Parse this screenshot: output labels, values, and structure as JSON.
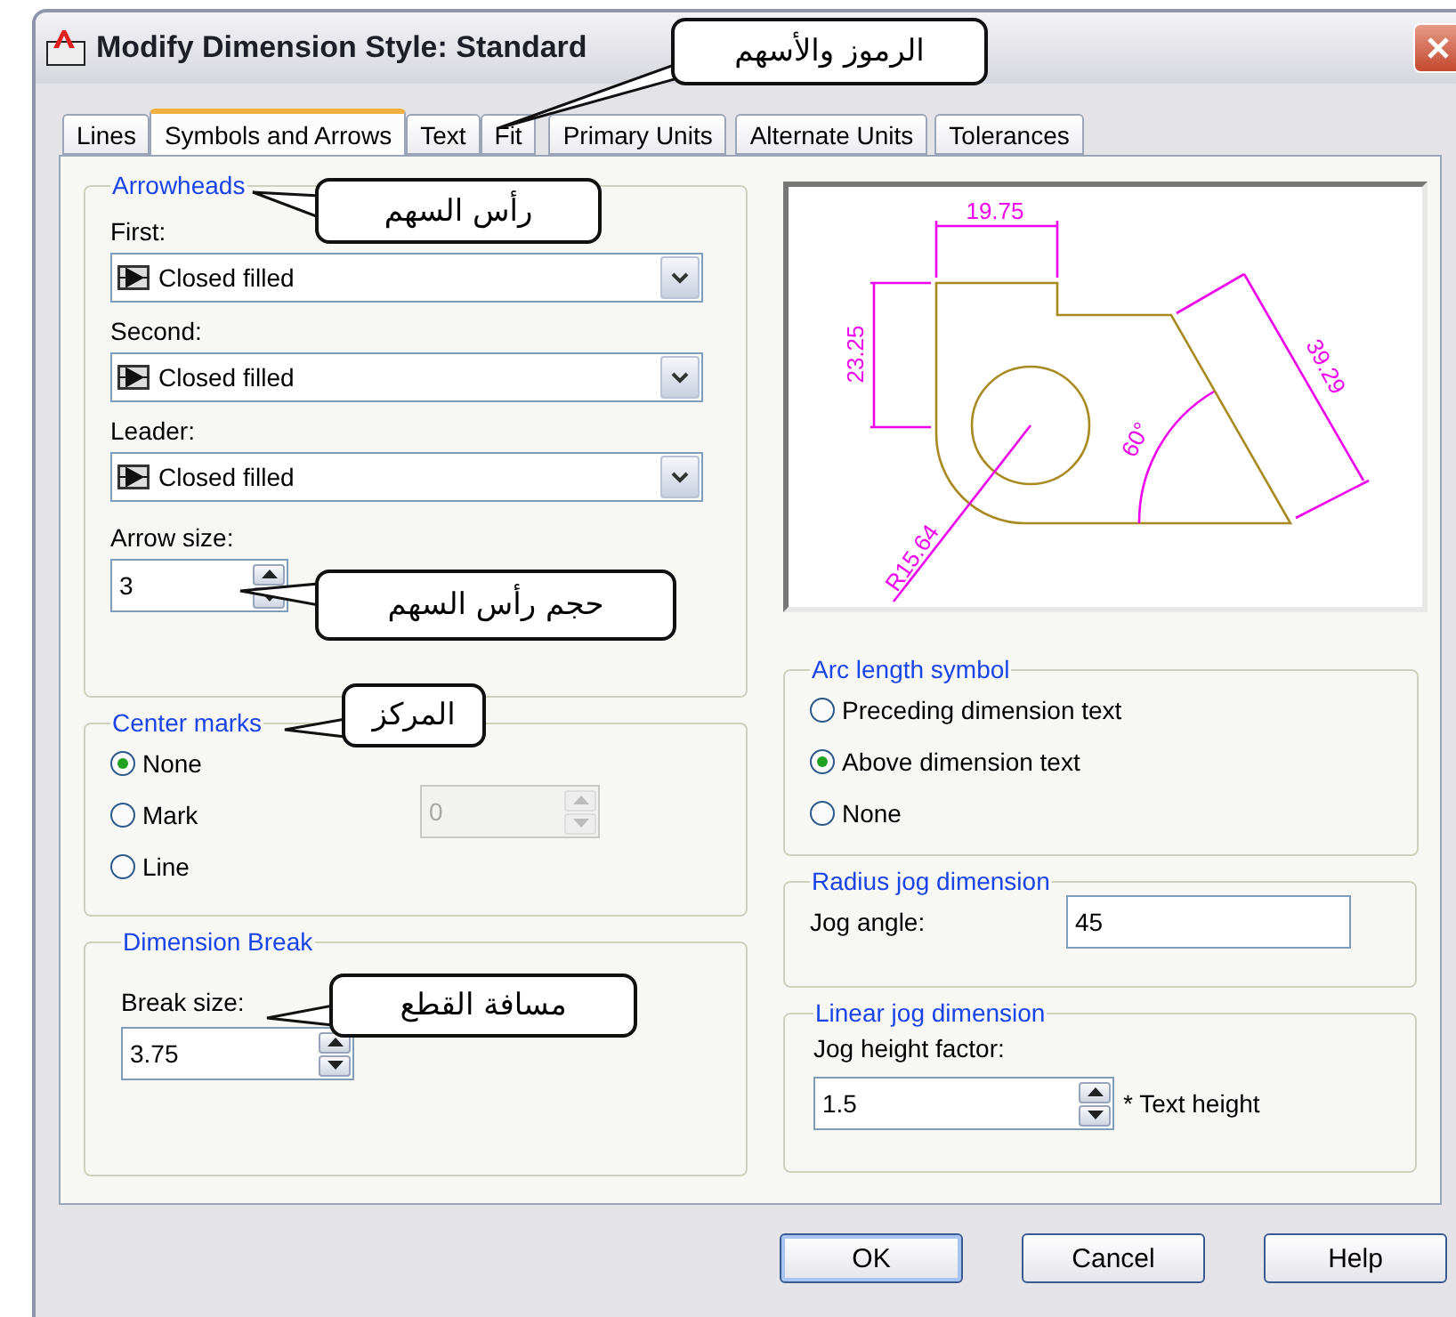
{
  "window": {
    "title": "Modify Dimension Style: Standard"
  },
  "tabs": [
    {
      "label": "Lines",
      "selected": false
    },
    {
      "label": "Symbols and Arrows",
      "selected": true
    },
    {
      "label": "Text",
      "selected": false
    },
    {
      "label": "Fit",
      "selected": false
    },
    {
      "label": "Primary Units",
      "selected": false
    },
    {
      "label": "Alternate Units",
      "selected": false
    },
    {
      "label": "Tolerances",
      "selected": false
    }
  ],
  "arrowheads": {
    "title": "Arrowheads",
    "fields": [
      {
        "label": "First:",
        "value": "Closed filled"
      },
      {
        "label": "Second:",
        "value": "Closed filled"
      },
      {
        "label": "Leader:",
        "value": "Closed filled"
      }
    ],
    "arrow_size": {
      "label": "Arrow size:",
      "value": "3"
    }
  },
  "center_marks": {
    "title": "Center marks",
    "options": [
      {
        "label": "None",
        "selected": true
      },
      {
        "label": "Mark",
        "selected": false
      },
      {
        "label": "Line",
        "selected": false
      }
    ],
    "size": {
      "value": "0",
      "disabled": true
    }
  },
  "dimension_break": {
    "title": "Dimension Break",
    "label": "Break size:",
    "value": "3.75"
  },
  "preview": {
    "labels": [
      {
        "text": "19.75"
      },
      {
        "text": "23.25"
      },
      {
        "text": "39.29"
      },
      {
        "text": "60°"
      },
      {
        "text": "R15.64"
      }
    ]
  },
  "arc_length_symbol": {
    "title": "Arc length symbol",
    "options": [
      {
        "label": "Preceding dimension text",
        "selected": false
      },
      {
        "label": "Above dimension text",
        "selected": true
      },
      {
        "label": "None",
        "selected": false
      }
    ]
  },
  "radius_jog": {
    "title": "Radius jog dimension",
    "label": "Jog angle:",
    "value": "45"
  },
  "linear_jog": {
    "title": "Linear jog dimension",
    "label": "Jog height factor:",
    "value": "1.5",
    "suffix": "* Text height"
  },
  "buttons": [
    "OK",
    "Cancel",
    "Help"
  ],
  "callouts": [
    {
      "text": "الرموز والأسهم"
    },
    {
      "text": "رأس السهم"
    },
    {
      "text": "حجم رأس السهم"
    },
    {
      "text": "المركز"
    },
    {
      "text": "مسافة القطع"
    }
  ]
}
